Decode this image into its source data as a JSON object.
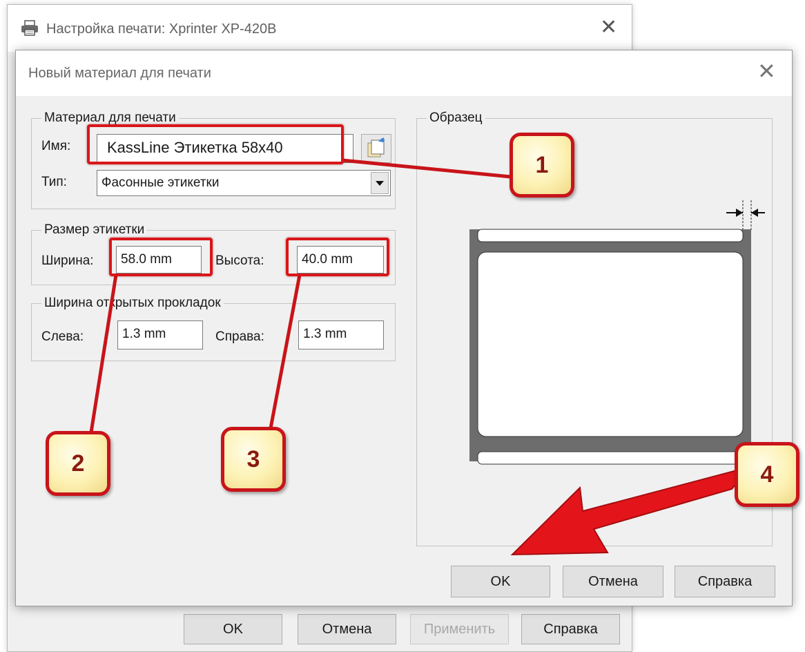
{
  "back_window": {
    "title": "Настройка печати: Xprinter XP-420B",
    "buttons": {
      "ok": "OK",
      "cancel": "Отмена",
      "apply": "Применить",
      "help": "Справка"
    }
  },
  "dialog": {
    "title": "Новый материал для печати",
    "material_group": {
      "label": "Материал для печати",
      "name_label": "Имя:",
      "name_value": "KassLine Этикетка 58x40",
      "type_label": "Тип:",
      "type_value": "Фасонные этикетки"
    },
    "size_group": {
      "label": "Размер этикетки",
      "width_label": "Ширина:",
      "width_value": "58.0 mm",
      "height_label": "Высота:",
      "height_value": "40.0 mm"
    },
    "liner_group": {
      "label": "Ширина открытых прокладок",
      "left_label": "Слева:",
      "left_value": "1.3 mm",
      "right_label": "Справа:",
      "right_value": "1.3 mm"
    },
    "sample_group": {
      "label": "Образец"
    },
    "buttons": {
      "ok": "OK",
      "cancel": "Отмена",
      "help": "Справка"
    }
  },
  "callouts": [
    "1",
    "2",
    "3",
    "4"
  ],
  "colors": {
    "highlight": "#d9161a",
    "callout_fill": "#fdf2b4",
    "callout_text": "#8b1a10"
  },
  "icons": [
    "printer-icon",
    "close-icon",
    "browse-icon",
    "dropdown-arrow-icon",
    "margin-arrows-icon",
    "red-arrow-pointer"
  ]
}
